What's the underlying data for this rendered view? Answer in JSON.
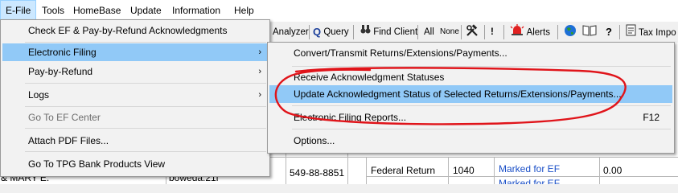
{
  "menubar": [
    "E-File",
    "Tools",
    "HomeBase",
    "Update",
    "Information",
    "Help"
  ],
  "toolbar": {
    "analyzer": "Analyzer",
    "query": "Query",
    "find_client": "Find Client",
    "all": "All",
    "none": "None",
    "alerts": "Alerts",
    "tax_import": "Tax Impo"
  },
  "efile_menu": {
    "items": [
      "Check EF & Pay-by-Refund Acknowledgments",
      "Electronic Filing",
      "Pay-by-Refund",
      "Logs",
      "Go To EF Center",
      "Attach PDF Files...",
      "Go To TPG Bank Products View"
    ]
  },
  "submenu": {
    "items": [
      "Convert/Transmit Returns/Extensions/Payments...",
      "Receive Acknowledgment Statuses",
      "Update Acknowledgment Status of Selected Returns/Extensions/Payments...",
      "Electronic Filing Reports...",
      "Options..."
    ],
    "reports_shortcut": "F12"
  },
  "background_row": {
    "name": "& MARY E.",
    "file": "boweda.21i",
    "ssn": "549-88-8851",
    "return_type": "Federal Return",
    "form": "1040",
    "status": "Marked for EF",
    "amount": "0.00",
    "status_partial": "Marked for EF"
  },
  "colors": {
    "highlight": "#91c9f7",
    "link_blue": "#1a4fc7",
    "annotation_red": "#e0141a"
  }
}
